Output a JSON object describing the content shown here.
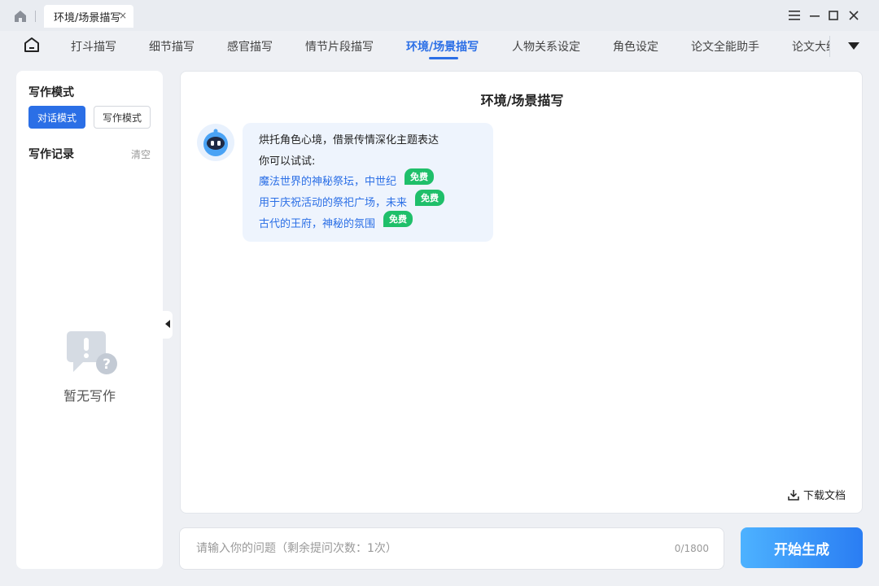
{
  "titlebar": {
    "tab_title": "环境/场景描写",
    "close_glyph": "×",
    "icons": [
      "home-icon",
      "menu-icon",
      "minimize-icon",
      "maximize-icon",
      "close-icon"
    ]
  },
  "nav": {
    "items": [
      "打斗描写",
      "细节描写",
      "感官描写",
      "情节片段描写",
      "环境/场景描写",
      "人物关系设定",
      "角色设定",
      "论文全能助手",
      "论文大纲"
    ],
    "active_index": 4
  },
  "sidebar": {
    "mode_title": "写作模式",
    "mode_buttons": [
      "对话模式",
      "写作模式"
    ],
    "record_title": "写作记录",
    "clear_label": "清空",
    "empty_text": "暂无写作"
  },
  "main": {
    "title": "环境/场景描写",
    "intro": "烘托角色心境，借景传情深化主题表达",
    "try_label": "你可以试试:",
    "suggestions": [
      "魔法世界的神秘祭坛，中世纪",
      "用于庆祝活动的祭祀广场，未来",
      "古代的王府，神秘的氛围"
    ],
    "badge_label": "免费",
    "download_label": "下载文档"
  },
  "input": {
    "placeholder": "请输入你的问题（剩余提问次数：1次）",
    "value": "",
    "counter": "0/1800"
  },
  "generate_label": "开始生成",
  "colors": {
    "accent": "#2b6fe6",
    "badge": "#1fbf6a",
    "bubble": "#eef4fd"
  }
}
